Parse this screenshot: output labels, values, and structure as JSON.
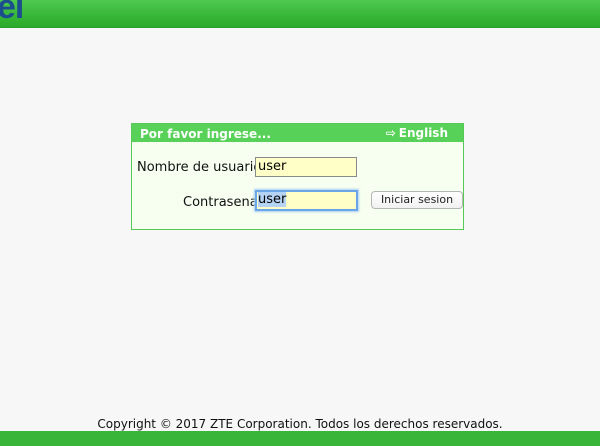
{
  "branding": {
    "logo_text": "el",
    "accent_color": "#39b539"
  },
  "login": {
    "title": "Por favor ingrese...",
    "language_icon": "arrow-right-outline-icon",
    "language_label": "English",
    "username_label": "Nombre de usuario",
    "username_value": "user",
    "password_label": "Contrasena",
    "password_value": "user",
    "submit_label": "Iniciar sesion"
  },
  "footer": {
    "copyright": "Copyright © 2017 ZTE Corporation. Todos los derechos reservados."
  }
}
